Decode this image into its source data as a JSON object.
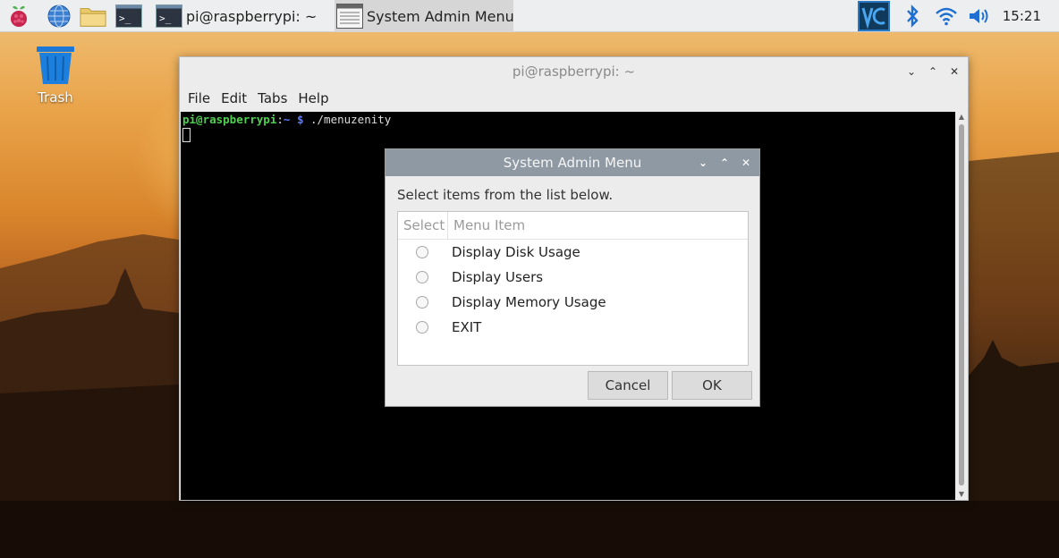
{
  "taskbar": {
    "icons": [
      "raspberry-menu-icon",
      "web-browser-icon",
      "file-manager-icon",
      "terminal-launcher-icon"
    ],
    "tasks": [
      {
        "label": "pi@raspberrypi: ~",
        "icon": "terminal-icon"
      },
      {
        "label": "System Admin Menu",
        "icon": "dialog-window-icon"
      }
    ],
    "tray": [
      "vnc-icon",
      "bluetooth-icon",
      "wifi-icon",
      "volume-icon"
    ],
    "clock": "15:21"
  },
  "desktop": {
    "trash_label": "Trash"
  },
  "terminal": {
    "title": "pi@raspberrypi: ~",
    "menu": [
      "File",
      "Edit",
      "Tabs",
      "Help"
    ],
    "prompt_user": "pi@raspberrypi",
    "prompt_sep": ":",
    "prompt_path": "~ $",
    "command": " ./menuzenity"
  },
  "dialog": {
    "title": "System Admin Menu",
    "prompt": "Select items from the list below.",
    "columns": [
      "Select",
      "Menu Item"
    ],
    "items": [
      "Display Disk Usage",
      "Display Users",
      "Display Memory Usage",
      "EXIT"
    ],
    "cancel_label": "Cancel",
    "ok_label": "OK"
  },
  "colors": {
    "dialog_titlebar": "#8f99a3",
    "prompt_user": "#4ed14e",
    "prompt_path": "#5b7cff"
  }
}
